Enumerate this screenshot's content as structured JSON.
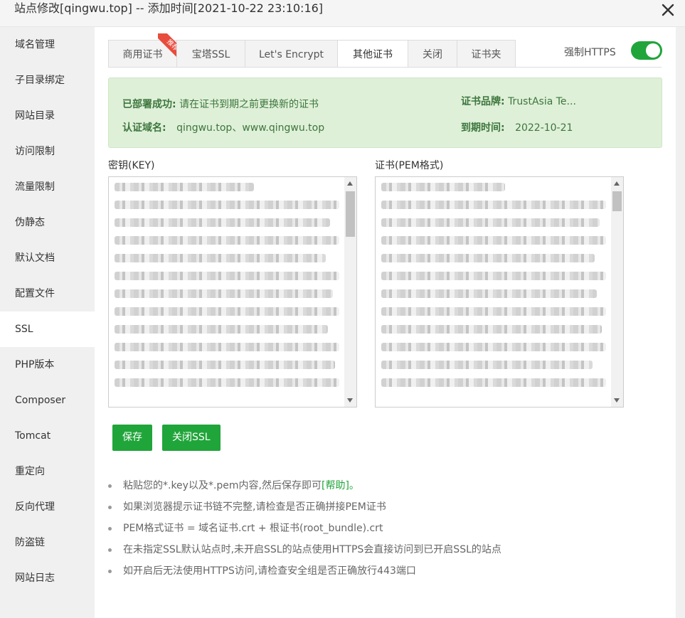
{
  "window": {
    "title": "站点修改[qingwu.top] -- 添加时间[2021-10-22 23:10:16]"
  },
  "sidebar": {
    "items": [
      {
        "label": "域名管理"
      },
      {
        "label": "子目录绑定"
      },
      {
        "label": "网站目录"
      },
      {
        "label": "访问限制"
      },
      {
        "label": "流量限制"
      },
      {
        "label": "伪静态"
      },
      {
        "label": "默认文档"
      },
      {
        "label": "配置文件"
      },
      {
        "label": "SSL",
        "active": true
      },
      {
        "label": "PHP版本"
      },
      {
        "label": "Composer"
      },
      {
        "label": "Tomcat"
      },
      {
        "label": "重定向"
      },
      {
        "label": "反向代理"
      },
      {
        "label": "防盗链"
      },
      {
        "label": "网站日志"
      }
    ]
  },
  "tabs": [
    {
      "label": "商用证书",
      "badge": "推荐"
    },
    {
      "label": "宝塔SSL"
    },
    {
      "label": "Let's Encrypt"
    },
    {
      "label": "其他证书",
      "active": true
    },
    {
      "label": "关闭"
    },
    {
      "label": "证书夹"
    }
  ],
  "force_https": {
    "label": "强制HTTPS",
    "enabled": true
  },
  "status": {
    "deploy_label": "已部署成功:",
    "deploy_text": "请在证书到期之前更换新的证书",
    "domain_label": "认证域名:",
    "domain_value": "qingwu.top、www.qingwu.top",
    "brand_label": "证书品牌:",
    "brand_value": "TrustAsia Te...",
    "expire_label": "到期时间:",
    "expire_value": "2022-10-21"
  },
  "key_field": {
    "label": "密钥(KEY)"
  },
  "cert_field": {
    "label": "证书(PEM格式)"
  },
  "buttons": {
    "save": "保存",
    "close_ssl": "关闭SSL"
  },
  "tips": {
    "tip1_prefix": "粘贴您的*.key以及*.pem内容,然后保存即可",
    "tip1_link": "[帮助]。",
    "tip2": "如果浏览器提示证书链不完整,请检查是否正确拼接PEM证书",
    "tip3": "PEM格式证书 = 域名证书.crt + 根证书(root_bundle).crt",
    "tip4": "在未指定SSL默认站点时,未开启SSL的站点使用HTTPS会直接访问到已开启SSL的站点",
    "tip5": "如开启后无法使用HTTPS访问,请检查安全组是否正确放行443端口"
  },
  "colors": {
    "accent": "#20a53a",
    "success_bg": "#dff0d8",
    "success_text": "#3c763d",
    "badge": "#e84c3d"
  }
}
